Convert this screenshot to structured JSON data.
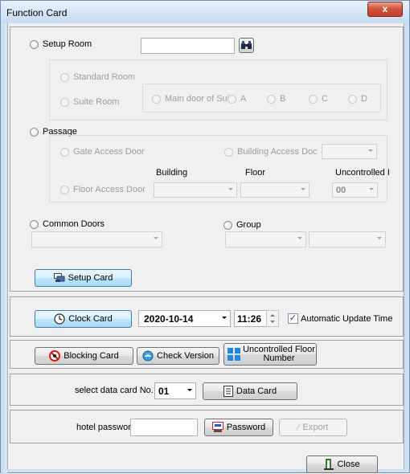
{
  "window": {
    "title": "Function Card",
    "close_glyph": "x"
  },
  "room": {
    "setup_room": "Setup Room",
    "room_input_value": "",
    "search_icon": "binoculars-icon",
    "standard_room": "Standard Room",
    "suite_room": "Suite Room",
    "main_door": "Main door of Sui",
    "opt_a": "A",
    "opt_b": "B",
    "opt_c": "C",
    "opt_d": "D"
  },
  "passage": {
    "label": "Passage",
    "gate_access": "Gate Access Door",
    "building_access": "Building Access Doc",
    "building_col": "Building",
    "floor_col": "Floor",
    "uncontrolled_col": "Uncontrolled I",
    "floor_access": "Floor Access Door",
    "uncontrolled_value": "00"
  },
  "common": {
    "common_doors": "Common Doors",
    "group": "Group",
    "setup_card": "Setup Card"
  },
  "clock": {
    "clock_card": "Clock Card",
    "date": "2020-10-14",
    "time": "11:26",
    "auto_update": "Automatic Update Time",
    "auto_update_checked": true
  },
  "actions": {
    "blocking_card": "Blocking Card",
    "check_version": "Check Version",
    "uncontrolled_floor_line1": "Uncontrolled Floor",
    "uncontrolled_floor_line2": "Number"
  },
  "datacard": {
    "select_label": "select data card No.",
    "card_no": "01",
    "data_card_btn": "Data Card"
  },
  "password": {
    "label": "hotel password",
    "value": "",
    "password_btn": "Password",
    "export_btn": "Export"
  },
  "footer": {
    "close_btn": "Close"
  }
}
